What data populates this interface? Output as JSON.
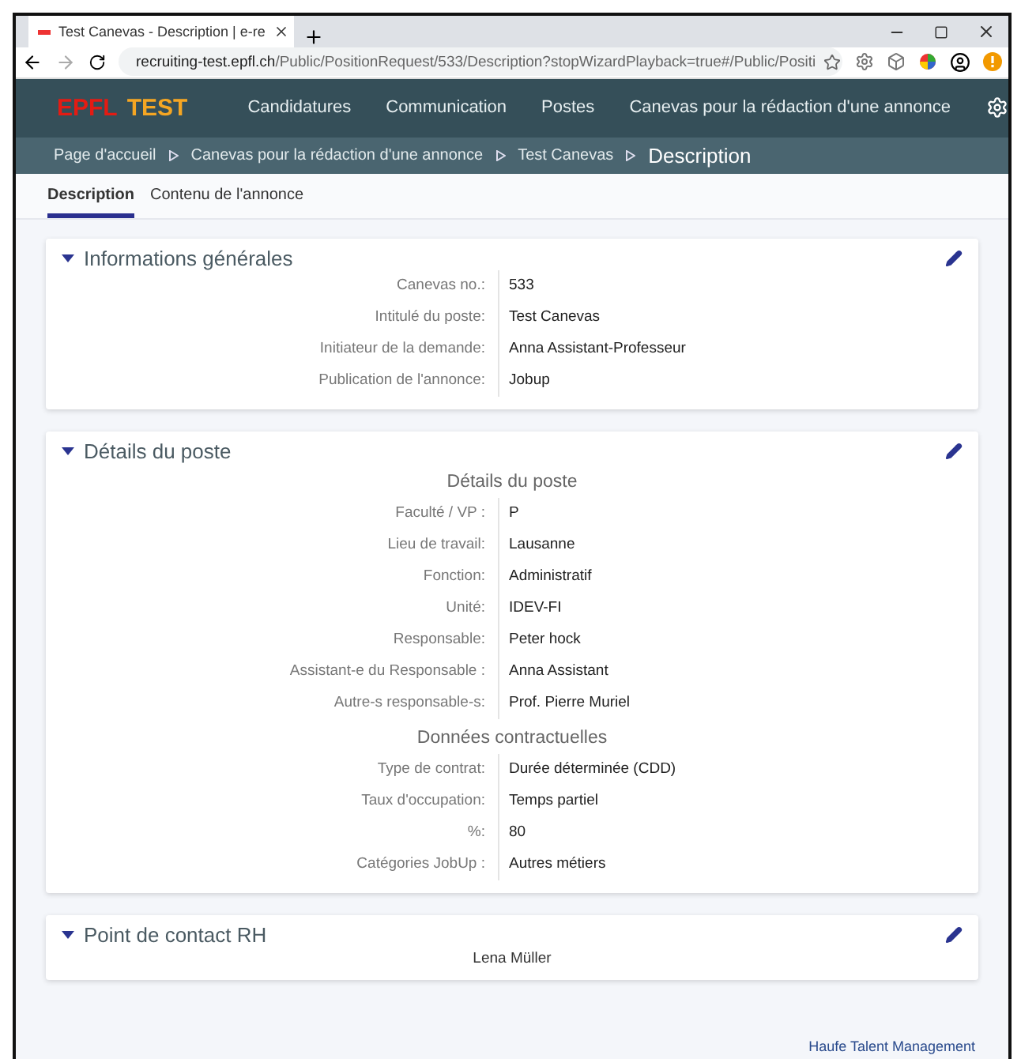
{
  "browser": {
    "tab_title": "Test Canevas - Description | e-re",
    "url_host": "recruiting-test.epfl.ch",
    "url_path": "/Public/PositionRequest/533/Description?stopWizardPlayback=true#/Public/Positi"
  },
  "header": {
    "logo_main": "EPFL",
    "logo_suffix": "TEST",
    "nav": [
      "Candidatures",
      "Communication",
      "Postes",
      "Canevas pour la rédaction d'une annonce"
    ]
  },
  "breadcrumbs": [
    "Page d'accueil",
    "Canevas pour la rédaction d'une annonce",
    "Test Canevas"
  ],
  "breadcrumb_current": "Description",
  "tabs": [
    {
      "label": "Description",
      "selected": true
    },
    {
      "label": "Contenu de l'annonce",
      "selected": false
    }
  ],
  "sections": [
    {
      "title": "Informations générales",
      "expanded": true,
      "groups": [
        {
          "rows": [
            {
              "label": "Canevas no.:",
              "value": "533"
            },
            {
              "label": "Intitulé du poste:",
              "value": "Test Canevas"
            },
            {
              "label": "Initiateur de la demande:",
              "value": "Anna Assistant-Professeur"
            },
            {
              "label": "Publication de l'annonce:",
              "value": "Jobup"
            }
          ]
        }
      ]
    },
    {
      "title": "Détails du poste",
      "expanded": true,
      "groups": [
        {
          "heading": "Détails du poste",
          "rows": [
            {
              "label": "Faculté / VP :",
              "value": "P"
            },
            {
              "label": "Lieu de travail:",
              "value": "Lausanne"
            },
            {
              "label": "Fonction:",
              "value": "Administratif"
            },
            {
              "label": "Unité:",
              "value": "IDEV-FI"
            },
            {
              "label": "Responsable:",
              "value": "Peter hock"
            },
            {
              "label": "Assistant-e du Responsable :",
              "value": "Anna Assistant"
            },
            {
              "label": "Autre-s responsable-s:",
              "value": "Prof. Pierre Muriel"
            }
          ]
        },
        {
          "heading": "Données contractuelles",
          "rows": [
            {
              "label": "Type de contrat:",
              "value": "Durée déterminée (CDD)"
            },
            {
              "label": "Taux d'occupation:",
              "value": "Temps partiel"
            },
            {
              "label": "%:",
              "value": "80"
            },
            {
              "label": "Catégories JobUp :",
              "value": "Autres métiers"
            }
          ]
        }
      ]
    },
    {
      "title": "Point de contact RH",
      "expanded": true,
      "text": "Lena Müller"
    }
  ],
  "footer_link": "Haufe Talent Management"
}
